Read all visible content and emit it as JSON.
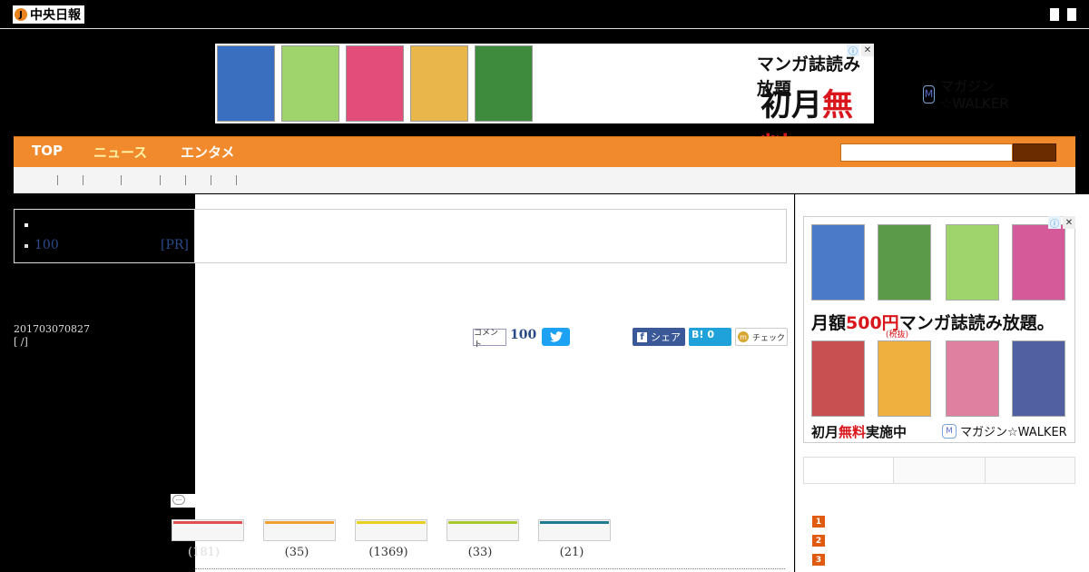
{
  "header": {
    "logo_icon": "J",
    "logo_text": "中央日報"
  },
  "top_banner": {
    "line1": "マンガ誌読み放題",
    "line2_pre": "初月",
    "line2_red": "無料",
    "brand": "マガジン☆WALKER",
    "brand_icon": "M",
    "ad_icon": "ⓘ",
    "close_icon": "✕",
    "cover_colors": [
      "#3a6fc0",
      "#9fd36c",
      "#e34d7a",
      "#e8b64a",
      "#3e8b3e"
    ]
  },
  "nav": {
    "items": [
      {
        "label": "TOP",
        "color": "#ffffff"
      },
      {
        "label": "ニュース",
        "color": "#fff3a6"
      },
      {
        "label": "エンタメ",
        "color": "#ffffff"
      }
    ]
  },
  "related": {
    "item2_count": "100",
    "item2_pr": "[PR]"
  },
  "article": {
    "date": "201703070827",
    "breadcrumb": "[ /]"
  },
  "share": {
    "comment_label": "コメント",
    "comment_count": "100",
    "twitter_icon": "bird-icon",
    "facebook_label": "シェア",
    "facebook_icon": "f",
    "hatena_label": "B!",
    "hatena_count": "0",
    "mixi_icon": "m",
    "mixi_label": "チェック"
  },
  "reactions": [
    {
      "color": "#e05050",
      "count": "(181)"
    },
    {
      "color": "#f0a030",
      "count": "(35)"
    },
    {
      "color": "#e8d020",
      "count": "(1369)"
    },
    {
      "color": "#a8c830",
      "count": "(33)"
    },
    {
      "color": "#207a90",
      "count": "(21)"
    }
  ],
  "side_ad": {
    "text_pre": "月額",
    "text_red": "500円",
    "text_post": "マンガ誌読み放題。",
    "note": "(税抜)",
    "bottom_pre": "初月",
    "bottom_red": "無料",
    "bottom_post": "実施中",
    "brand": "マガジン☆WALKER",
    "brand_icon": "M",
    "ad_icon": "ⓘ",
    "close_icon": "✕"
  },
  "ranking": {
    "numbers": [
      "1",
      "2",
      "3"
    ]
  }
}
